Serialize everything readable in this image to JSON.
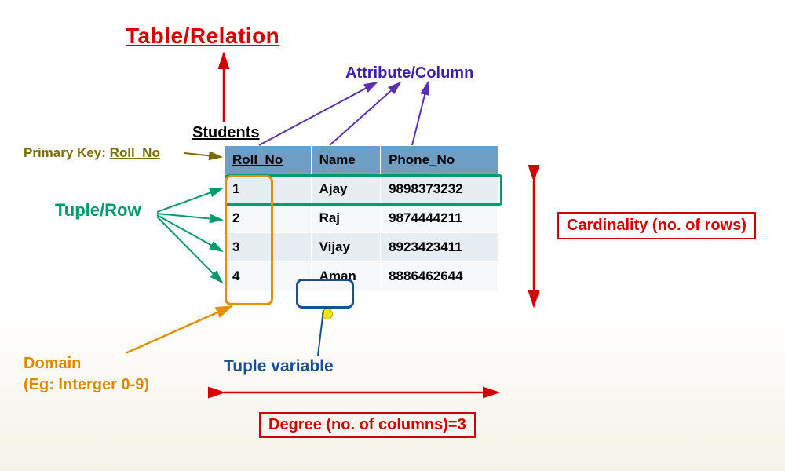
{
  "title": "Table/Relation",
  "table_name": "Students",
  "labels": {
    "attribute": "Attribute/Column",
    "primary_key_prefix": "Primary Key:",
    "primary_key_value": "Roll_No",
    "tuple_row": "Tuple/Row",
    "domain_line1": "Domain",
    "domain_line2": "(Eg: Interger 0-9)",
    "tuple_variable": "Tuple variable",
    "cardinality": "Cardinality (no. of rows)",
    "degree": "Degree (no. of columns)=3"
  },
  "columns": {
    "c0": "Roll_No",
    "c1": "Name",
    "c2": "Phone_No"
  },
  "rows": [
    {
      "roll": "1",
      "name": "Ajay",
      "phone": "9898373232"
    },
    {
      "roll": "2",
      "name": "Raj",
      "phone": "9874444211"
    },
    {
      "roll": "3",
      "name": "Vijay",
      "phone": "8923423411"
    },
    {
      "roll": "4",
      "name": "Aman",
      "phone": "8886462644"
    }
  ],
  "chart_data": {
    "type": "table",
    "title": "Students",
    "columns": [
      "Roll_No",
      "Name",
      "Phone_No"
    ],
    "primary_key": "Roll_No",
    "rows": [
      [
        1,
        "Ajay",
        "9898373232"
      ],
      [
        2,
        "Raj",
        "9874444211"
      ],
      [
        3,
        "Vijay",
        "8923423411"
      ],
      [
        4,
        "Aman",
        "8886462644"
      ]
    ],
    "degree": 3,
    "cardinality": 4,
    "annotations": {
      "tuple_example_row_index": 0,
      "domain_example_column": "Roll_No",
      "domain_example_text": "Interger 0-9",
      "tuple_variable_example_cell": {
        "row_index": 3,
        "column": "Name",
        "value": "Aman"
      }
    }
  }
}
